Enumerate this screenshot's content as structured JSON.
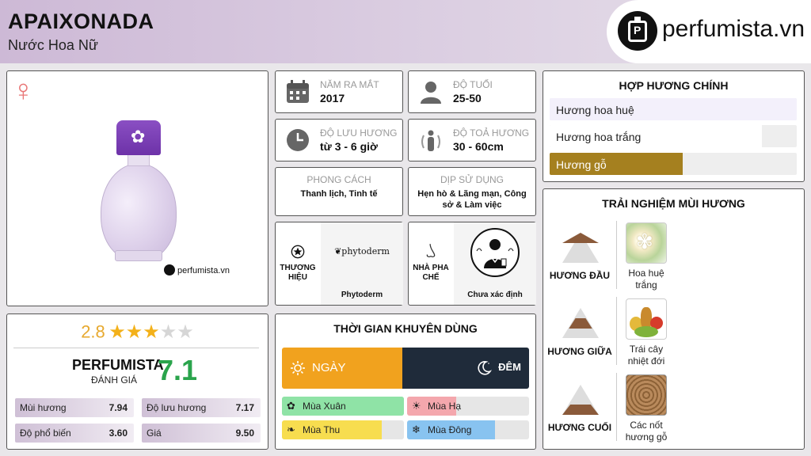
{
  "header": {
    "title": "APAIXONADA",
    "subtitle": "Nước Hoa Nữ",
    "logo_text": "perfumista.vn"
  },
  "product": {
    "gender_symbol": "♀",
    "image_caption": "perfumista.vn",
    "colors": {
      "cap": "#7a3fb8",
      "glass": "#d6c8e6",
      "gender": "#e97777"
    }
  },
  "rating": {
    "score": "2.8",
    "stars": 2.8,
    "perfumista_label": "PERFUMISTA",
    "perfumista_sub": "ĐÁNH GIÁ",
    "perfumista_score": "7.1",
    "metrics": [
      {
        "label": "Mùi hương",
        "value": "7.94"
      },
      {
        "label": "Độ lưu hương",
        "value": "7.17"
      },
      {
        "label": "Độ phổ biến",
        "value": "3.60"
      },
      {
        "label": "Giá",
        "value": "9.50"
      }
    ]
  },
  "info": {
    "year": {
      "label": "NĂM RA MẮT",
      "value": "2017",
      "icon": "calendar-icon"
    },
    "age": {
      "label": "ĐỘ TUỔI",
      "value": "25-50",
      "icon": "person-icon"
    },
    "longevity": {
      "label": "ĐỘ LƯU HƯƠNG",
      "value": "từ 3 - 6 giờ",
      "icon": "clock-icon"
    },
    "sillage": {
      "label": "ĐỘ TOẢ HƯƠNG",
      "value": "30 - 60cm",
      "icon": "sillage-icon"
    },
    "style": {
      "label": "PHONG CÁCH",
      "value": "Thanh lịch, Tinh tế"
    },
    "occasion": {
      "label": "DỊP SỬ DỤNG",
      "value": "Hẹn hò & Lãng mạn, Công sở & Làm việc"
    },
    "brand": {
      "label": "THƯƠNG HIỆU",
      "logo": "phytoderm",
      "name": "Phytoderm"
    },
    "perfumer": {
      "label": "NHÀ PHA CHẾ",
      "name": "Chưa xác định"
    }
  },
  "time": {
    "title": "THỜI GIAN KHUYÊN DÙNG",
    "day_label": "NGÀY",
    "night_label": "ĐÊM",
    "day_color": "#f1a21e",
    "night_color": "#1f2b3a",
    "seasons": [
      {
        "label": "Mùa Xuân",
        "fill": 1.0,
        "color": "#8fe3a6",
        "icon": "flower-icon"
      },
      {
        "label": "Mùa Hạ",
        "fill": 0.4,
        "color": "#f4a7ad",
        "icon": "sun-icon"
      },
      {
        "label": "Mùa Thu",
        "fill": 0.82,
        "color": "#f7dd4f",
        "icon": "leaf-icon"
      },
      {
        "label": "Mùa Đông",
        "fill": 0.72,
        "color": "#88c3f0",
        "icon": "snowflake-icon"
      }
    ]
  },
  "accords": {
    "title": "HỢP HƯƠNG CHÍNH",
    "items": [
      {
        "label": "Hương hoa huệ",
        "fill": 1.0,
        "color": "#f3f0fb",
        "text_color": "#222222"
      },
      {
        "label": "Hương hoa trắng",
        "fill": 0.86,
        "color": "#ffffff",
        "text_color": "#222222"
      },
      {
        "label": "Hương gỗ",
        "fill": 0.54,
        "color": "#a5801f",
        "text_color": "#ffffff"
      }
    ]
  },
  "notes": {
    "title": "TRẢI NGHIỆM MÙI HƯƠNG",
    "layers": [
      {
        "label": "HƯƠNG ĐẦU",
        "note": "Hoa huệ trắng"
      },
      {
        "label": "HƯƠNG GIỮA",
        "note": "Trái cây nhiệt đới"
      },
      {
        "label": "HƯƠNG CUỐI",
        "note": "Các nốt hương gỗ"
      }
    ]
  }
}
